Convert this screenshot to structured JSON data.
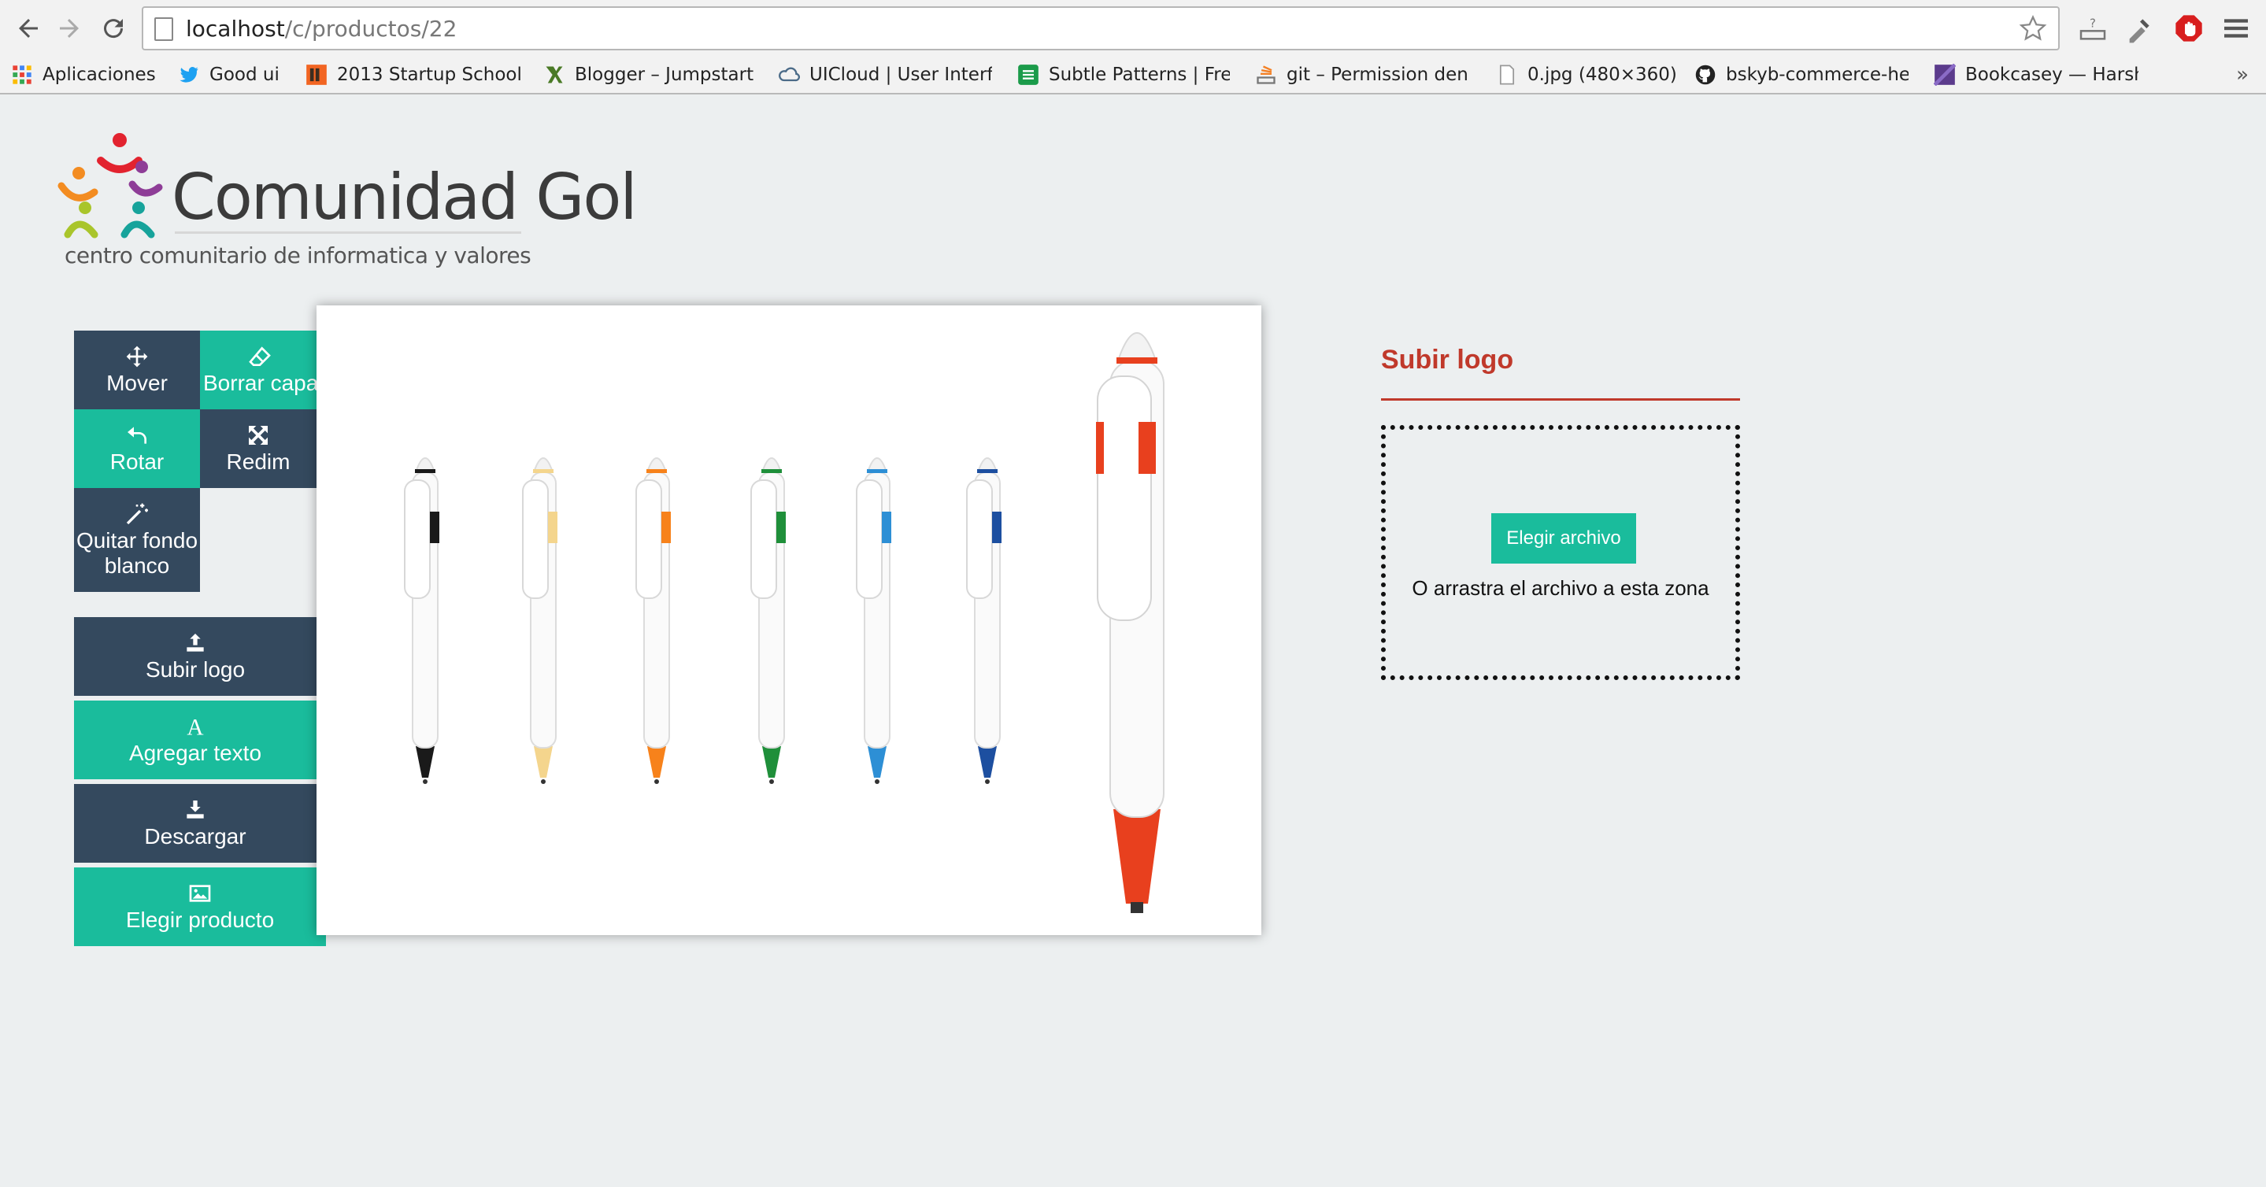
{
  "browser": {
    "url_host": "localhost",
    "url_path": "/c/productos/22",
    "bookmarks": [
      {
        "label": "Aplicaciones",
        "icon": "apps-grid-icon"
      },
      {
        "label": "Good ui",
        "icon": "twitter-bird-icon"
      },
      {
        "label": "2013 Startup School",
        "icon": "startup-school-icon"
      },
      {
        "label": "Blogger – Jumpstart",
        "icon": "blogger-icon"
      },
      {
        "label": "UICloud | User Interf",
        "icon": "cloud-icon"
      },
      {
        "label": "Subtle Patterns | Fre",
        "icon": "subtle-patterns-icon"
      },
      {
        "label": "git – Permission den",
        "icon": "stack-icon"
      },
      {
        "label": "0.jpg (480×360)",
        "icon": "file-icon"
      },
      {
        "label": "bskyb-commerce-he",
        "icon": "github-icon"
      },
      {
        "label": "Bookcasey — Harsh",
        "icon": "bookcasey-icon"
      }
    ],
    "more": "»"
  },
  "logo": {
    "title": "Comunidad Gol",
    "subtitle": "centro comunitario de informatica y valores"
  },
  "tools": {
    "mover": "Mover",
    "borrar_capa": "Borrar capa",
    "rotar": "Rotar",
    "redim": "Redim",
    "quitar_fondo_1": "Quitar fondo",
    "quitar_fondo_2": "blanco"
  },
  "actions": {
    "subir_logo": "Subir logo",
    "agregar_texto": "Agregar texto",
    "descargar": "Descargar",
    "elegir_producto": "Elegir producto"
  },
  "product": {
    "pen_colors": [
      "#1a1a1a",
      "#f4d58d",
      "#f7821b",
      "#1f8f3a",
      "#2d8fd5",
      "#1d4fa0"
    ],
    "large_pen_color": "#e8401e"
  },
  "upload": {
    "title": "Subir logo",
    "button": "Elegir archivo",
    "drop_text": "O arrastra el archivo a esta zona"
  },
  "colors": {
    "dark": "#34495e",
    "teal": "#1abc9c",
    "red": "#c0392b"
  }
}
